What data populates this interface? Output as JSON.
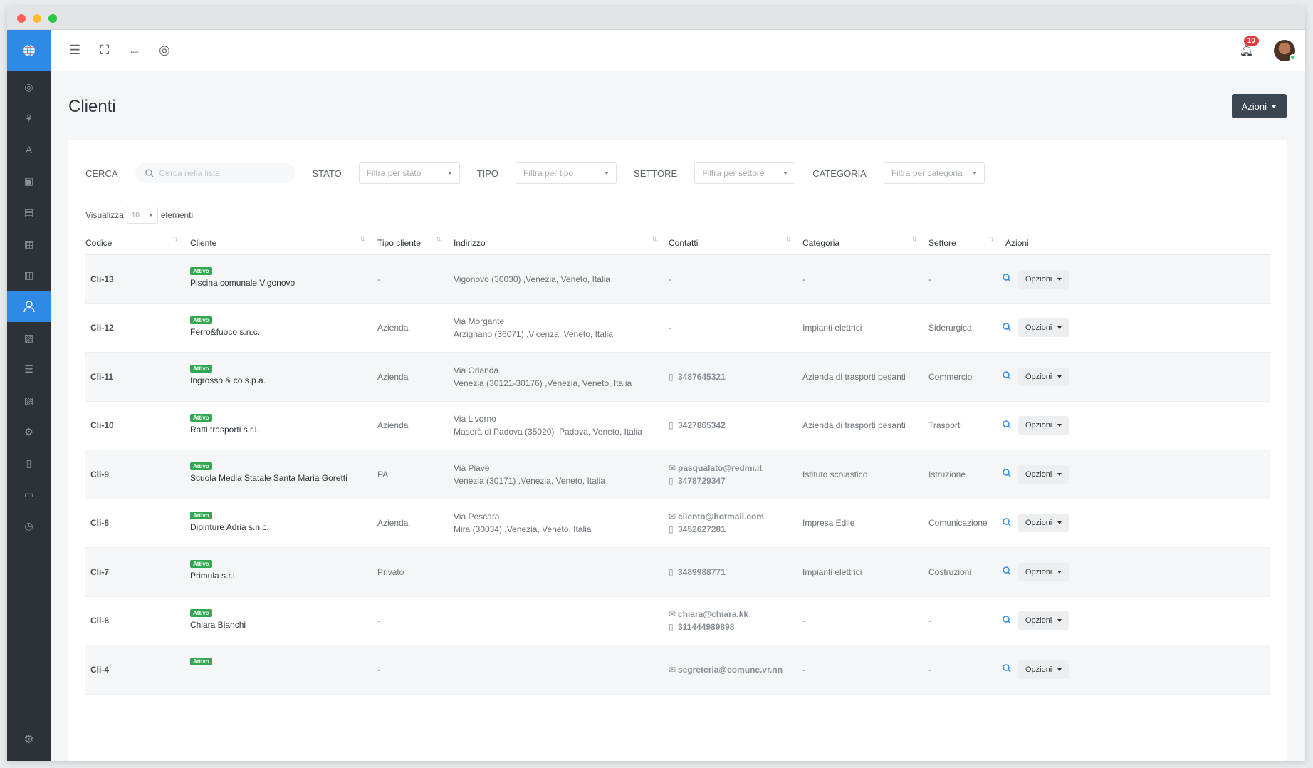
{
  "page": {
    "title": "Clienti",
    "actions_label": "Azioni"
  },
  "topbar": {
    "notification_count": "10"
  },
  "filters": {
    "search_label": "CERCA",
    "search_placeholder": "Cerca nella lista",
    "stato_label": "STATO",
    "stato_placeholder": "Filtra per stato",
    "tipo_label": "TIPO",
    "tipo_placeholder": "Filtra per tipo",
    "settore_label": "SETTORE",
    "settore_placeholder": "Filtra per settore",
    "categoria_label": "CATEGORIA",
    "categoria_placeholder": "Filtra per categoria"
  },
  "perpage": {
    "prefix": "Visualizza",
    "value": "10",
    "suffix": "elementi"
  },
  "table": {
    "headers": {
      "codice": "Codice",
      "cliente": "Cliente",
      "tipo": "Tipo cliente",
      "indirizzo": "Indirizzo",
      "contatti": "Contatti",
      "categoria": "Categoria",
      "settore": "Settore",
      "azioni": "Azioni"
    },
    "sort_glyph": "↑↓",
    "status_badge": "Attivo",
    "options_label": "Opzioni",
    "rows": [
      {
        "code": "Cli-13",
        "name": "Piscina comunale Vigonovo",
        "tipo": "-",
        "addr1": "",
        "addr2": "Vigonovo (30030) ,Venezia, Veneto, Italia",
        "email": "",
        "phone": "",
        "dash": "-",
        "cat": "-",
        "set": "-"
      },
      {
        "code": "Cli-12",
        "name": "Ferro&fuoco s.n.c.",
        "tipo": "Azienda",
        "addr1": "Via Morgante",
        "addr2": "Arzignano (36071) ,Vicenza, Veneto, Italia",
        "email": "",
        "phone": "",
        "dash": "-",
        "cat": "Impianti elettrici",
        "set": "Siderurgica"
      },
      {
        "code": "Cli-11",
        "name": "Ingrosso & co s.p.a.",
        "tipo": "Azienda",
        "addr1": "Via Orlanda",
        "addr2": "Venezia (30121-30176) ,Venezia, Veneto, Italia",
        "email": "",
        "phone": "3487645321",
        "dash": "",
        "cat": "Azienda di trasporti pesanti",
        "set": "Commercio"
      },
      {
        "code": "Cli-10",
        "name": "Ratti trasporti s.r.l.",
        "tipo": "Azienda",
        "addr1": "Via Livorno",
        "addr2": "Maserà di Padova (35020) ,Padova, Veneto, Italia",
        "email": "",
        "phone": "3427865342",
        "dash": "",
        "cat": "Azienda di trasporti pesanti",
        "set": "Trasporti"
      },
      {
        "code": "Cli-9",
        "name": "Scuola Media Statale Santa Maria Goretti",
        "tipo": "PA",
        "addr1": "Via Piave",
        "addr2": "Venezia (30171) ,Venezia, Veneto, Italia",
        "email": "pasqualato@redmi.it",
        "phone": "3478729347",
        "dash": "",
        "cat": "Istituto scolastico",
        "set": "Istruzione"
      },
      {
        "code": "Cli-8",
        "name": "Dipinture Adria s.n.c.",
        "tipo": "Azienda",
        "addr1": "Via Pescara",
        "addr2": "Mira (30034) ,Venezia, Veneto, Italia",
        "email": "cilento@hotmail.com",
        "phone": "3452627281",
        "dash": "",
        "cat": "Impresa Edile",
        "set": "Comunicazione"
      },
      {
        "code": "Cli-7",
        "name": "Primula s.r.l.",
        "tipo": "Privato",
        "addr1": "",
        "addr2": "",
        "email": "",
        "phone": "3489988771",
        "dash": "",
        "cat": "Impianti elettrici",
        "set": "Costruzioni"
      },
      {
        "code": "Cli-6",
        "name": "Chiara Bianchi",
        "tipo": "-",
        "addr1": "",
        "addr2": "",
        "email": "chiara@chiara.kk",
        "phone": "311444989898",
        "dash": "",
        "cat": "-",
        "set": "-"
      },
      {
        "code": "Cli-4",
        "name": "",
        "tipo": "-",
        "addr1": "",
        "addr2": "",
        "email": "segreteria@comune.vr.nn",
        "phone": "",
        "dash": "",
        "cat": "-",
        "set": "-"
      }
    ]
  }
}
